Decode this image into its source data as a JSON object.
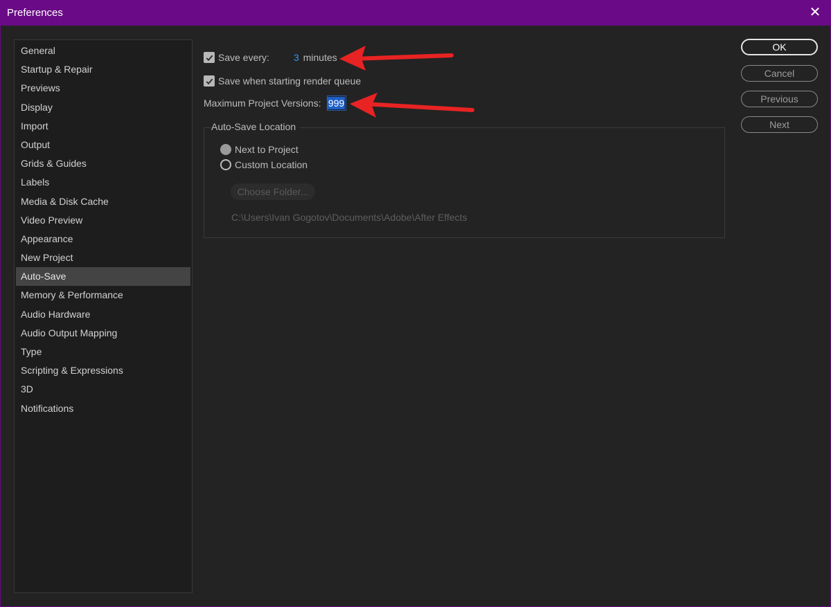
{
  "window": {
    "title": "Preferences"
  },
  "sidebar": {
    "items": [
      {
        "label": "General"
      },
      {
        "label": "Startup & Repair"
      },
      {
        "label": "Previews"
      },
      {
        "label": "Display"
      },
      {
        "label": "Import"
      },
      {
        "label": "Output"
      },
      {
        "label": "Grids & Guides"
      },
      {
        "label": "Labels"
      },
      {
        "label": "Media & Disk Cache"
      },
      {
        "label": "Video Preview"
      },
      {
        "label": "Appearance"
      },
      {
        "label": "New Project"
      },
      {
        "label": "Auto-Save"
      },
      {
        "label": "Memory & Performance"
      },
      {
        "label": "Audio Hardware"
      },
      {
        "label": "Audio Output Mapping"
      },
      {
        "label": "Type"
      },
      {
        "label": "Scripting & Expressions"
      },
      {
        "label": "3D"
      },
      {
        "label": "Notifications"
      }
    ],
    "active": "Auto-Save"
  },
  "autosave": {
    "save_every_label": "Save every:",
    "save_every_value": "3",
    "save_every_unit": "minutes",
    "save_render_label": "Save when starting render queue",
    "max_versions_label": "Maximum Project Versions:",
    "max_versions_value": "999",
    "location_legend": "Auto-Save Location",
    "next_to_project_label": "Next to Project",
    "custom_location_label": "Custom Location",
    "choose_folder_label": "Choose Folder...",
    "path": "C:\\Users\\Ivan Gogotov\\Documents\\Adobe\\After Effects"
  },
  "buttons": {
    "ok": "OK",
    "cancel": "Cancel",
    "previous": "Previous",
    "next": "Next"
  },
  "colors": {
    "titlebar": "#6a0a86",
    "accent_link": "#3b8fe8",
    "annotation_arrow": "#e82323"
  }
}
